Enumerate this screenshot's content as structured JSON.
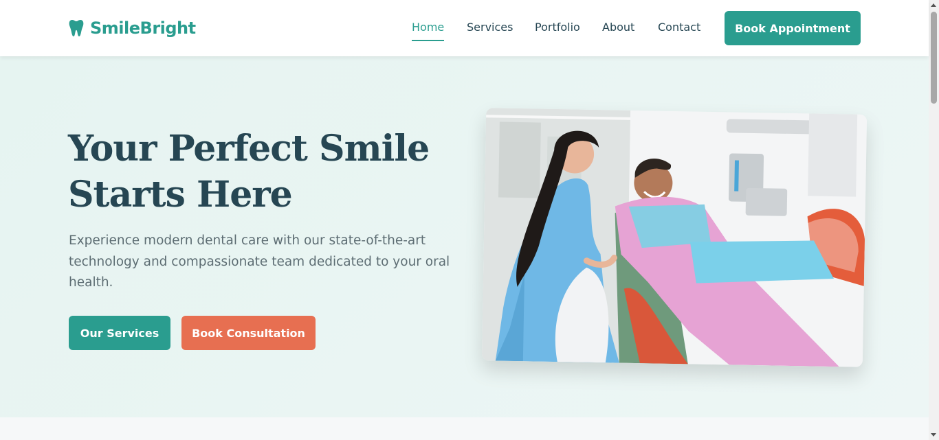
{
  "brand": {
    "name": "SmileBright",
    "icon": "tooth-icon"
  },
  "nav": {
    "items": [
      {
        "label": "Home",
        "active": true
      },
      {
        "label": "Services",
        "active": false
      },
      {
        "label": "Portfolio",
        "active": false
      },
      {
        "label": "About",
        "active": false
      },
      {
        "label": "Contact",
        "active": false
      }
    ],
    "cta_label": "Book Appointment"
  },
  "hero": {
    "title_line1": "Your Perfect Smile",
    "title_line2": "Starts Here",
    "description": "Experience modern dental care with our state-of-the-art technology and compassionate team dedicated to your oral health.",
    "primary_button": "Our Services",
    "secondary_button": "Book Consultation"
  },
  "colors": {
    "primary": "#2a9d8f",
    "accent": "#e76f51",
    "heading": "#264653",
    "hero_bg": "#e9f5f3"
  }
}
